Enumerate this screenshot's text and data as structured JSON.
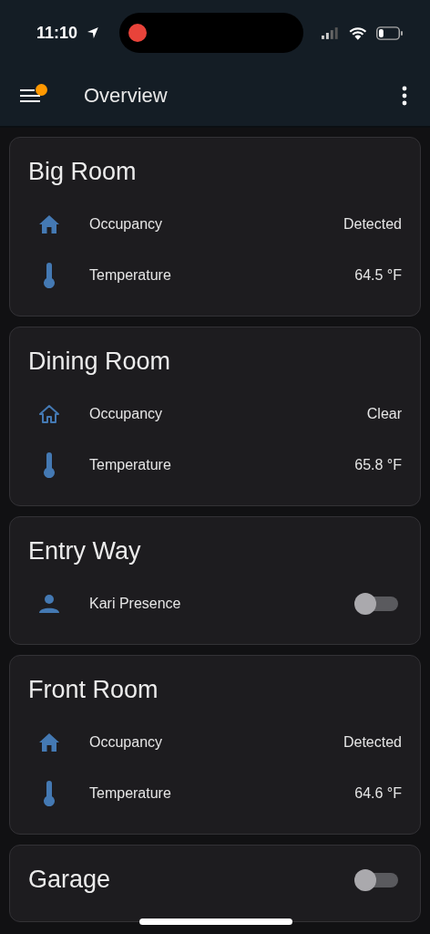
{
  "status_bar": {
    "time": "11:10",
    "recording": true
  },
  "header": {
    "title": "Overview",
    "notification": true
  },
  "cards": [
    {
      "title": "Big Room",
      "rows": [
        {
          "kind": "occupancy",
          "active": true,
          "name": "Occupancy",
          "value": "Detected"
        },
        {
          "kind": "temperature",
          "name": "Temperature",
          "value": "64.5 °F"
        }
      ]
    },
    {
      "title": "Dining Room",
      "rows": [
        {
          "kind": "occupancy",
          "active": false,
          "name": "Occupancy",
          "value": "Clear"
        },
        {
          "kind": "temperature",
          "name": "Temperature",
          "value": "65.8 °F"
        }
      ]
    },
    {
      "title": "Entry Way",
      "rows": [
        {
          "kind": "person",
          "name": "Kari Presence",
          "on": false
        }
      ]
    },
    {
      "title": "Front Room",
      "rows": [
        {
          "kind": "occupancy",
          "active": true,
          "name": "Occupancy",
          "value": "Detected"
        },
        {
          "kind": "temperature",
          "name": "Temperature",
          "value": "64.6 °F"
        }
      ]
    },
    {
      "title": "Garage",
      "header_toggle": {
        "on": false
      }
    }
  ]
}
